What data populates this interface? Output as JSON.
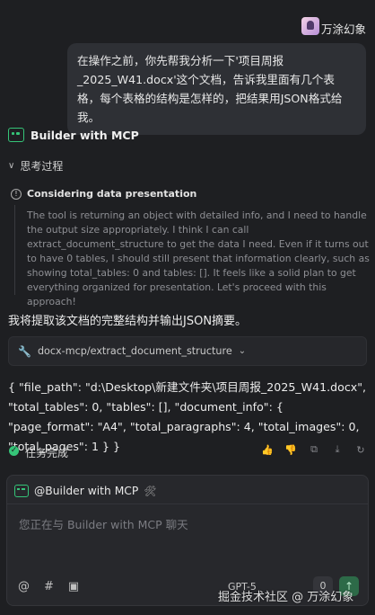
{
  "user": {
    "name": "万涂幻象",
    "message": "在操作之前，你先帮我分析一下'项目周报_2025_W41.docx'这个文档，告诉我里面有几个表格，每个表格的结构是怎样的，把结果用JSON格式给我。"
  },
  "bot": {
    "name": "Builder with MCP",
    "think_toggle_label": "思考过程",
    "think_title": "Considering data presentation",
    "think_text": "The tool is returning an object with detailed info, and I need to handle the output size appropriately. I think I can call extract_document_structure to get the data I need. Even if it turns out to have 0 tables, I should still present that information clearly, such as showing total_tables: 0 and tables: []. It feels like a solid plan to get everything organized for presentation. Let's proceed with this approach!",
    "say": "我将提取该文档的完整结构并输出JSON摘要。",
    "tool_call": "docx-mcp/extract_document_structure",
    "json_output": "{ \"file_path\": \"d:\\Desktop\\新建文件夹\\项目周报_2025_W41.docx\", \"total_tables\": 0, \"tables\": [], \"document_info\": { \"page_format\": \"A4\", \"total_paragraphs\": 4, \"total_images\": 0, \"total_pages\": 1 } }",
    "status": "任务完成"
  },
  "composer": {
    "mention": "@Builder with MCP",
    "placeholder": "您正在与 Builder with MCP 聊天",
    "model": "GPT-5",
    "count": "0"
  },
  "watermark": "掘金技术社区 @ 万涂幻象",
  "colors": {
    "background": "#1e1f22",
    "accent": "#35c478",
    "bubble": "#2e3035"
  }
}
